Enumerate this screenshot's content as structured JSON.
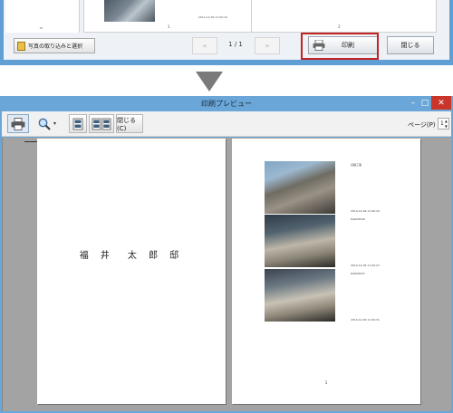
{
  "top_dialog": {
    "photo_button_label": "写真の取り込みと選択",
    "pager_prev": "«",
    "pager_count": "1 / 1",
    "pager_next": "»",
    "print_button_label": "印刷",
    "close_button_label": "閉じる",
    "thumbnail_date": "2014-12-09 11:06:16",
    "page_number_1": "1",
    "page_number_2": "2"
  },
  "preview_window": {
    "title": "印刷プレビュー",
    "minimize": "–",
    "maximize": "□",
    "close": "✕",
    "toolbar": {
      "close_label": "閉じる(C)",
      "page_label": "ページ(P)",
      "page_value": "1"
    },
    "left_page": {
      "owner_name": "福 井　太 郎 邸"
    },
    "right_page": {
      "photo_1_title": "基礎工事",
      "photo_1_date": "2014-12-09 11:06:16",
      "photo_2_file": "DA609526",
      "photo_2_date": "2014-12-09 11:09:27",
      "photo_3_file": "DA609527",
      "photo_3_date": "2014-12-09 11:09:31",
      "page_number": "1"
    }
  },
  "icons": [
    "printer-icon",
    "zoom-icon",
    "single-page-icon",
    "two-page-icon",
    "photo-import-icon",
    "arrow-down-icon"
  ],
  "colors": {
    "title_bar": "#6aa7d8",
    "close_button": "#c9352b",
    "highlight": "#c22222",
    "preview_background": "#a3a3a3"
  }
}
